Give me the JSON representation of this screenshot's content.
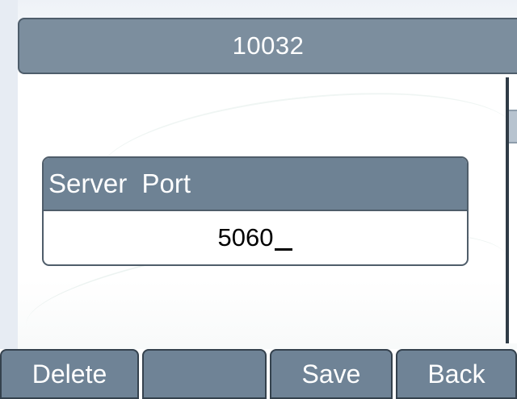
{
  "header": {
    "title": "10032"
  },
  "field": {
    "label": "Server  Port",
    "value": "5060"
  },
  "softkeys": [
    {
      "label": "Delete"
    },
    {
      "label": ""
    },
    {
      "label": "Save"
    },
    {
      "label": "Back"
    }
  ],
  "colors": {
    "title_bar": "#7c8e9e",
    "label_bar": "#6e8294",
    "softkey": "#6f8396"
  }
}
